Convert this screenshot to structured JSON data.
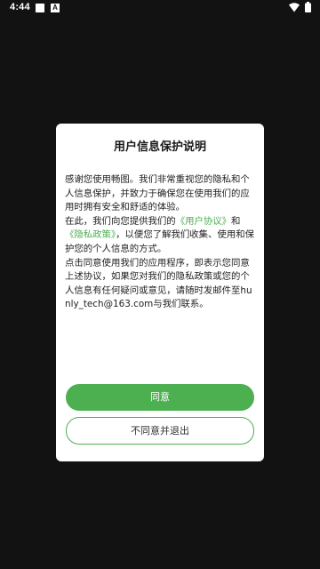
{
  "status_bar": {
    "time": "4:44",
    "notification_icons": [
      "square-icon",
      "a-icon"
    ],
    "a_glyph": "A",
    "system_icons": [
      "wifi-icon",
      "battery-icon"
    ]
  },
  "dialog": {
    "title": "用户信息保护说明",
    "paragraph1": "感谢您使用畅图。我们非常重视您的隐私和个人信息保护，并致力于确保您在使用我们的应用时拥有安全和舒适的体验。",
    "paragraph2_prefix": "在此，我们向您提供我们的",
    "user_agreement_link": "《用户协议》",
    "paragraph2_and": "和",
    "privacy_policy_link": "《隐私政策》",
    "paragraph2_suffix": "，以便您了解我们收集、使用和保护您的个人信息的方式。",
    "paragraph3": "点击同意使用我们的应用程序，即表示您同意上述协议，如果您对我们的隐私政策或您的个人信息有任何疑问或意见，请随时发邮件至hunly_tech@163.com与我们联系。",
    "agree_label": "同意",
    "decline_label": "不同意并退出"
  },
  "colors": {
    "accent": "#4caf50",
    "background": "#121212",
    "dialog_background": "#ffffff"
  }
}
